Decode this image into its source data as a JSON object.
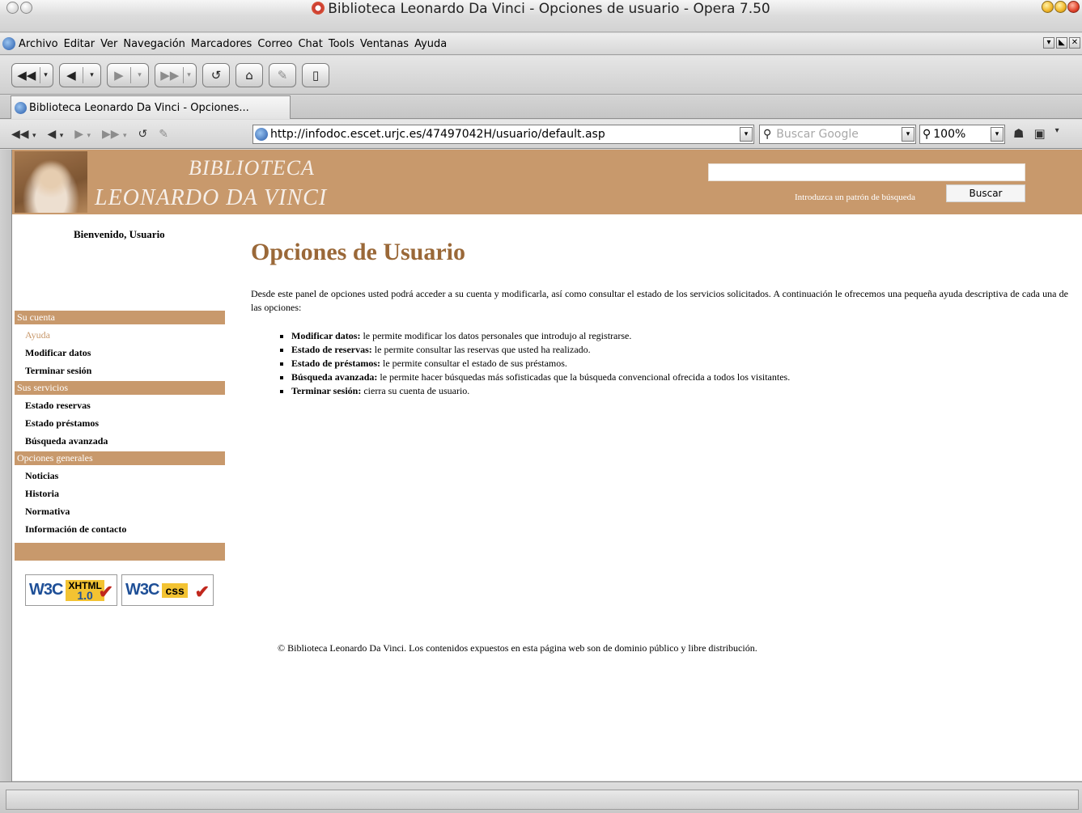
{
  "window": {
    "title": "Biblioteca Leonardo Da Vinci - Opciones de usuario - Opera 7.50"
  },
  "menu": [
    "Archivo",
    "Editar",
    "Ver",
    "Navegación",
    "Marcadores",
    "Correo",
    "Chat",
    "Tools",
    "Ventanas",
    "Ayuda"
  ],
  "tab": {
    "label": "Biblioteca Leonardo Da Vinci - Opciones..."
  },
  "address": {
    "url": "http://infodoc.escet.urjc.es/47497042H/usuario/default.asp",
    "search_placeholder": "Buscar Google",
    "zoom": "100%"
  },
  "banner": {
    "line1": "BIBLIOTECA",
    "line2": "LEONARDO DA VINCI",
    "search_hint": "Introduzca un patrón de búsqueda",
    "search_button": "Buscar"
  },
  "welcome": "Bienvenido, Usuario",
  "sidebar": {
    "section1": "Su cuenta",
    "items1": [
      "Ayuda",
      "Modificar datos",
      "Terminar sesión"
    ],
    "section2": "Sus servicios",
    "items2": [
      "Estado reservas",
      "Estado préstamos",
      "Búsqueda avanzada"
    ],
    "section3": "Opciones generales",
    "items3": [
      "Noticias",
      "Historia",
      "Normativa",
      "Información de contacto"
    ]
  },
  "badges": {
    "xhtml": {
      "w3c": "W3C",
      "label": "XHTML",
      "version": "1.0"
    },
    "css": {
      "w3c": "W3C",
      "label": "css"
    }
  },
  "main": {
    "heading": "Opciones de Usuario",
    "intro": "Desde este panel de opciones usted podrá acceder a su cuenta y modificarla, así como consultar el estado de los servicios solicitados. A continuación le ofrecemos una pequeña ayuda descriptiva de cada una de las opciones:",
    "items": [
      {
        "term": "Modificar datos:",
        "desc": " le permite modificar los datos personales que introdujo al registrarse."
      },
      {
        "term": "Estado de reservas:",
        "desc": " le permite consultar las reservas que usted ha realizado."
      },
      {
        "term": "Estado de préstamos:",
        "desc": " le permite consultar el estado de sus préstamos."
      },
      {
        "term": "Búsqueda avanzada:",
        "desc": " le permite hacer búsquedas más sofisticadas que la búsqueda convencional ofrecida a todos los visitantes."
      },
      {
        "term": "Terminar sesión:",
        "desc": " cierra su cuenta de usuario."
      }
    ],
    "copyright": "© Biblioteca Leonardo Da Vinci. Los contenidos expuestos en esta página web son de dominio público y libre distribución."
  },
  "colors": {
    "accent": "#c8996c",
    "heading": "#9a6838"
  }
}
